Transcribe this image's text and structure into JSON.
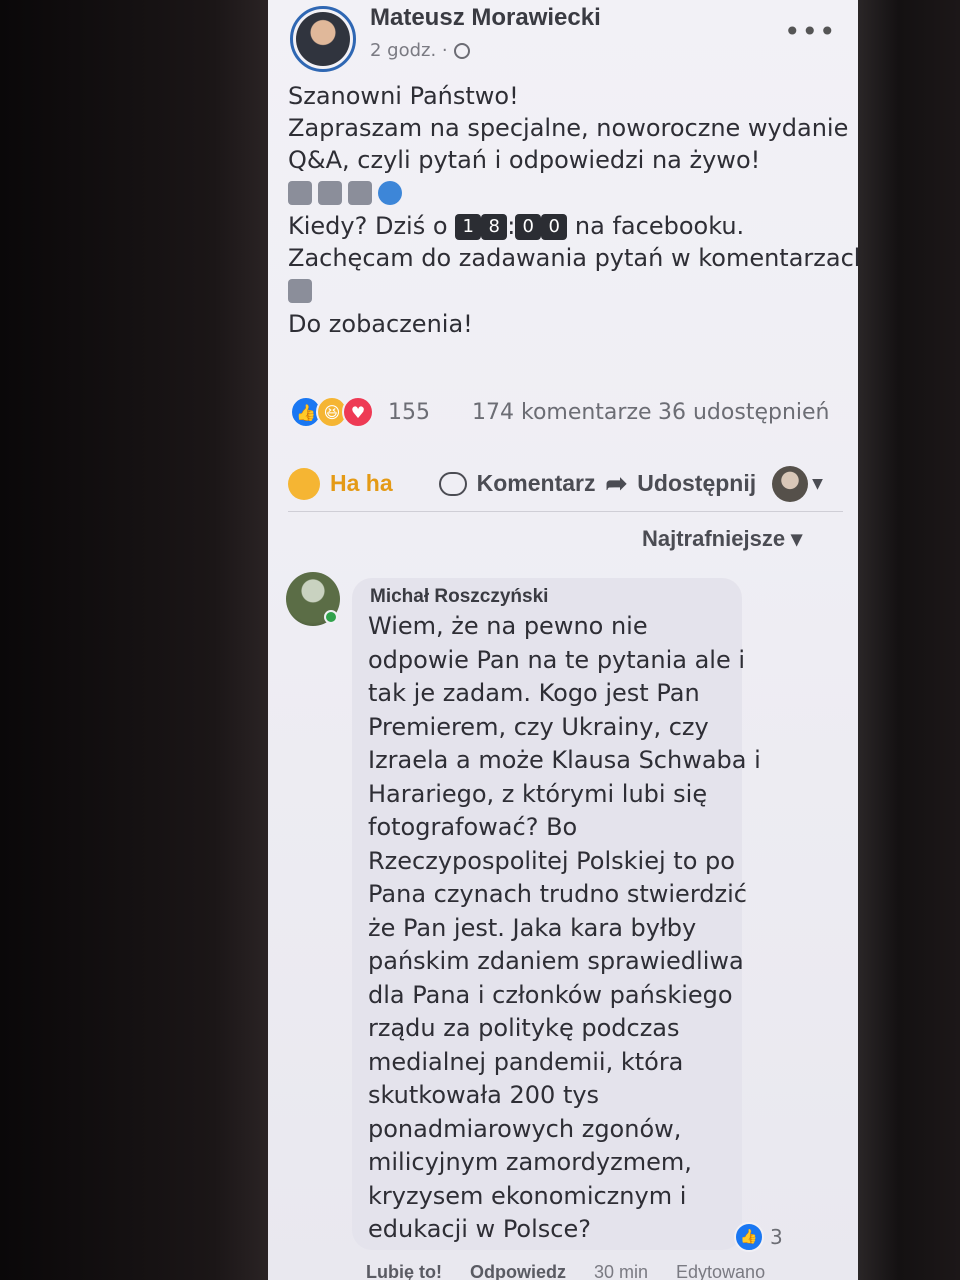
{
  "post": {
    "author": "Mateusz Morawiecki",
    "time": "2 godz. ·",
    "more": "•••",
    "lines": [
      "Szanowni Państwo!",
      "Zapraszam na specjalne, noworoczne wydanie",
      "Q&A, czyli pytań i odpowiedzi na żywo!"
    ],
    "when_prefix": "Kiedy? Dziś o",
    "time_digits": [
      "1",
      "8",
      "0",
      "0"
    ],
    "time_separator": ":",
    "when_suffix": "na facebooku.",
    "encourage": "Zachęcam do zadawania pytań w komentarzach",
    "bye": "Do zobaczenia!"
  },
  "stats": {
    "reactions_count": "155",
    "comments": "174 komentarze",
    "shares": "36 udostępnień"
  },
  "actions": {
    "reaction_label": "Ha ha",
    "comment_label": "Komentarz",
    "share_label": "Udostępnij",
    "caret": "▼"
  },
  "sort": {
    "label": "Najtrafniejsze ▾"
  },
  "comment": {
    "author": "Michał Roszczyński",
    "lines": [
      "Wiem, że na pewno nie",
      "odpowie Pan na te pytania ale i",
      "tak je zadam. Kogo jest Pan",
      "Premierem, czy Ukrainy, czy",
      "Izraela a może Klausa Schwaba i",
      "Harariego, z którymi lubi się",
      "fotografować? Bo",
      "Rzeczypospolitej Polskiej to po",
      "Pana czynach trudno stwierdzić",
      "że Pan jest. Jaka kara byłby",
      "pańskim zdaniem sprawiedliwa",
      "dla Pana i członków pańskiego",
      "rządu za politykę podczas",
      "medialnej pandemii, która",
      "skutkowała 200 tys",
      "ponadmiarowych zgonów,",
      "milicyjnym zamordyzmem,",
      "kryzysem ekonomicznym i",
      "edukacji w Polsce?"
    ],
    "likes": "3",
    "like_action": "Lubię to!",
    "reply_action": "Odpowiedz",
    "age": "30 min",
    "edited": "Edytowano"
  },
  "colors": {
    "like": "#1a77f2",
    "haha": "#f5b533",
    "love": "#ee3a54",
    "online": "#31a24c"
  }
}
